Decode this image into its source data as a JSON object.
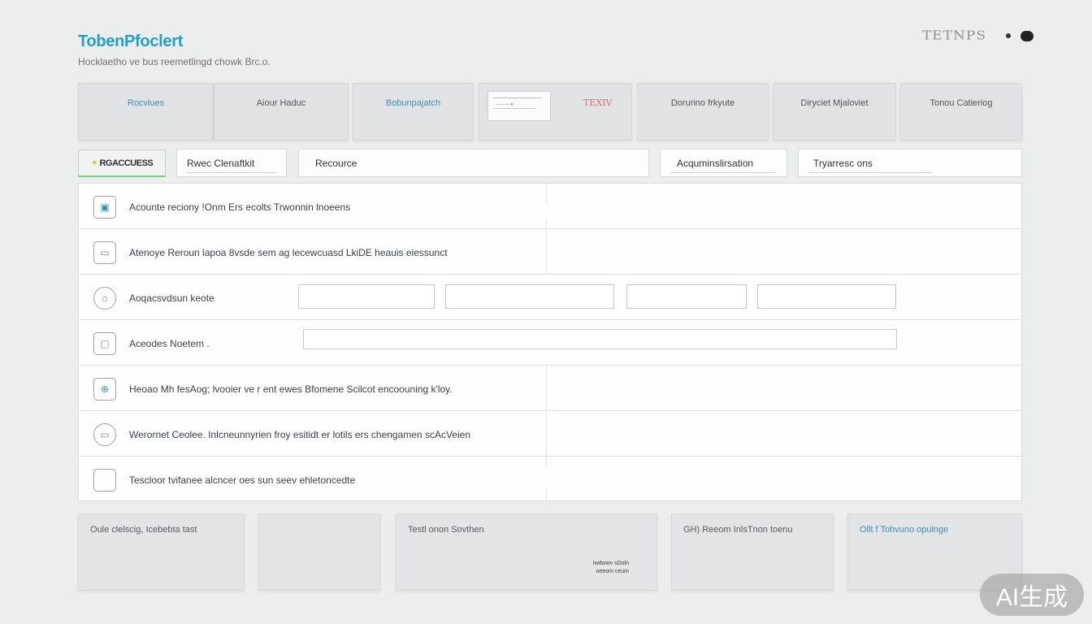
{
  "header": {
    "title": "TobenPfoclert",
    "subtitle": "Hocklaetho ve bus reemetlingd chowk Brc.o.",
    "logo_text": "TETNPS"
  },
  "filters": [
    {
      "label": "Rocvlues"
    },
    {
      "label": "Aiour Haduc"
    },
    {
      "label": "Bobunpajatch"
    },
    {
      "label": "",
      "mini_text": "-------- e",
      "stamp": "TEXIV"
    },
    {
      "label": "Dorurino frkyute"
    },
    {
      "label": "Diryciet Mjaloviet"
    },
    {
      "label": "Tonou Catieriog"
    }
  ],
  "tabs": {
    "active": "RGACCUESS",
    "items": [
      "Rwec Clenaftkit",
      "Recource",
      "Acquminslirsation",
      "Tryarresc ons"
    ]
  },
  "rows": [
    {
      "icon": "folder-icon",
      "text": "Acounte reciony !Onm Ers ecolts Trwonnin lnoeens"
    },
    {
      "icon": "card-icon",
      "text": "Atenoye Reroun lapoa 8vsde sem ag lecewcuasd LkiDE heauis eiessunct"
    },
    {
      "icon": "device-icon",
      "text": "Aoqacsvdsun keote"
    },
    {
      "icon": "clipboard-icon",
      "text": "Aceodes Noetem ."
    },
    {
      "icon": "link-icon",
      "text": "Heoao Mh fesAog; lvooier ve r ent ewes Bfomene Scilcot encoouning k'loy."
    },
    {
      "icon": "folder-round-icon",
      "text": "Werornet Ceolee.  Inlcneunnyrien froy esitidt er lotils ers chengamen scAcVeien"
    },
    {
      "icon": "square-icon",
      "text": "Tescloor tvifanee alcncer oes sun seev ehletoncedte"
    }
  ],
  "summary_cards": [
    {
      "label": "Oule clelscig, Icebebta tast",
      "foot": ""
    },
    {
      "label": "",
      "foot": ""
    },
    {
      "label": "Testl onon Sovthen",
      "foot": "lwdwwv sDoln\noeeom ceum"
    },
    {
      "label": "GH) Reeom InlsTnon toenu",
      "foot": ""
    },
    {
      "label": "Ollt f Tohvuno opulnge",
      "foot": ""
    }
  ],
  "watermark": "AI生成",
  "colors": {
    "brand": "#1f9fc9",
    "accent_tab": "#6fcf7a",
    "background": "#eceded"
  }
}
